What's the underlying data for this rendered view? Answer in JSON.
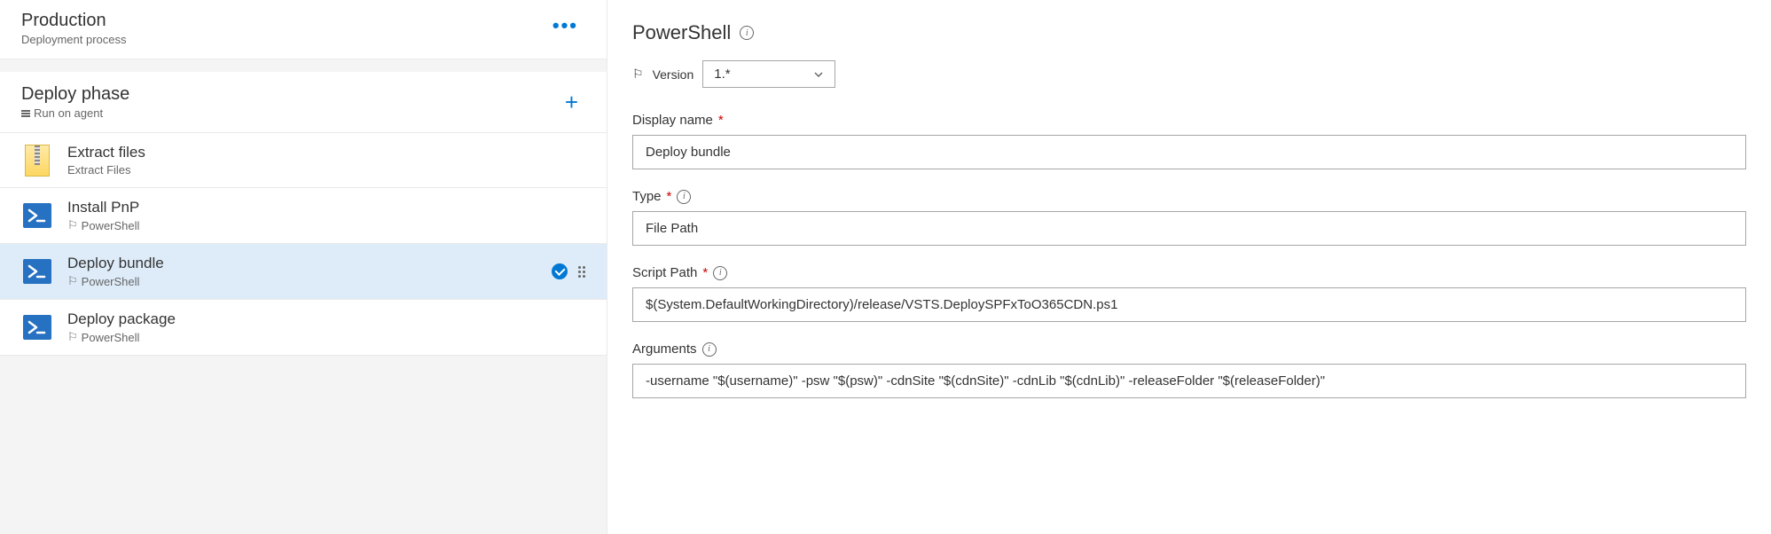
{
  "header": {
    "title": "Production",
    "subtitle": "Deployment process"
  },
  "phase": {
    "title": "Deploy phase",
    "subtitle": "Run on agent"
  },
  "tasks": [
    {
      "title": "Extract files",
      "subtitle": "Extract Files",
      "icon": "zip",
      "selected": false,
      "linked": false
    },
    {
      "title": "Install PnP",
      "subtitle": "PowerShell",
      "icon": "ps",
      "selected": false,
      "linked": true
    },
    {
      "title": "Deploy bundle",
      "subtitle": "PowerShell",
      "icon": "ps",
      "selected": true,
      "linked": true
    },
    {
      "title": "Deploy package",
      "subtitle": "PowerShell",
      "icon": "ps",
      "selected": false,
      "linked": true
    }
  ],
  "detail": {
    "heading": "PowerShell",
    "version_label": "Version",
    "version_value": "1.*",
    "display_name_label": "Display name",
    "display_name_value": "Deploy bundle",
    "type_label": "Type",
    "type_value": "File Path",
    "script_path_label": "Script Path",
    "script_path_value": "$(System.DefaultWorkingDirectory)/release/VSTS.DeploySPFxToO365CDN.ps1",
    "arguments_label": "Arguments",
    "arguments_value": "-username \"$(username)\" -psw \"$(psw)\" -cdnSite \"$(cdnSite)\" -cdnLib \"$(cdnLib)\" -releaseFolder \"$(releaseFolder)\""
  }
}
